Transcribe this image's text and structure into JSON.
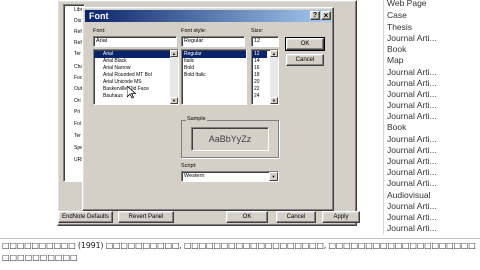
{
  "right_list": [
    "Web Page",
    "Case",
    "Thesis",
    "Journal Arti...",
    "Book",
    "Map",
    "Journal Arti...",
    "Journal Arti...",
    "Journal Arti...",
    "Journal Arti...",
    "Journal Arti...",
    "Book",
    "Journal Arti...",
    "Journal Arti...",
    "Journal Arti...",
    "Journal Arti...",
    "Journal Arti...",
    "Audiovisual",
    "Journal Arti...",
    "Journal Arti...",
    "Journal Arti..."
  ],
  "bg_panel_items": [
    "Libr",
    "Dis",
    "Ref",
    "Ref",
    "Ter",
    "Cha",
    "Foo",
    "Out",
    "Ori",
    "Pri",
    "Fol",
    "Ter",
    "Spe",
    "URI"
  ],
  "bottom_text": {
    "line1": "□□□□□□□□□□ (1991) □□□□□□□□□□, □□□□□□□□□□□□□□□□□□□, □□□□□□□□□□□□□□□□□□□□",
    "line2": "□□□□□□□□□□"
  },
  "dialog": {
    "title": "Font",
    "help_glyph": "?",
    "close_glyph": "×",
    "font_label": "Font:",
    "font_value": "Arial",
    "fonts": [
      "Arial",
      "Arial Black",
      "Arial Narrow",
      "Arial Rounded MT Bol",
      "Arial Unicode MS",
      "Baskerville Old Face",
      "Bauhaus"
    ],
    "style_label": "Font style:",
    "style_value": "Regular",
    "styles": [
      "Regular",
      "Italic",
      "Bold",
      "Bold Italic"
    ],
    "size_label": "Size:",
    "size_value": "12",
    "sizes": [
      "12",
      "14",
      "16",
      "18",
      "20",
      "22",
      "24"
    ],
    "ok": "OK",
    "cancel": "Cancel",
    "sample_label": "Sample",
    "sample_text": "AaBbYyZz",
    "script_label": "Script:",
    "script_value": "Western"
  },
  "bottom_buttons": {
    "endnote_defaults": "EndNote Defaults",
    "revert_panel": "Revert Panel",
    "ok": "OK",
    "cancel": "Cancel",
    "apply": "Apply"
  },
  "colors": {
    "titlebar_start": "#0a246a",
    "titlebar_end": "#a6caf0",
    "face": "#d4d0c8",
    "selection": "#0a246a"
  }
}
